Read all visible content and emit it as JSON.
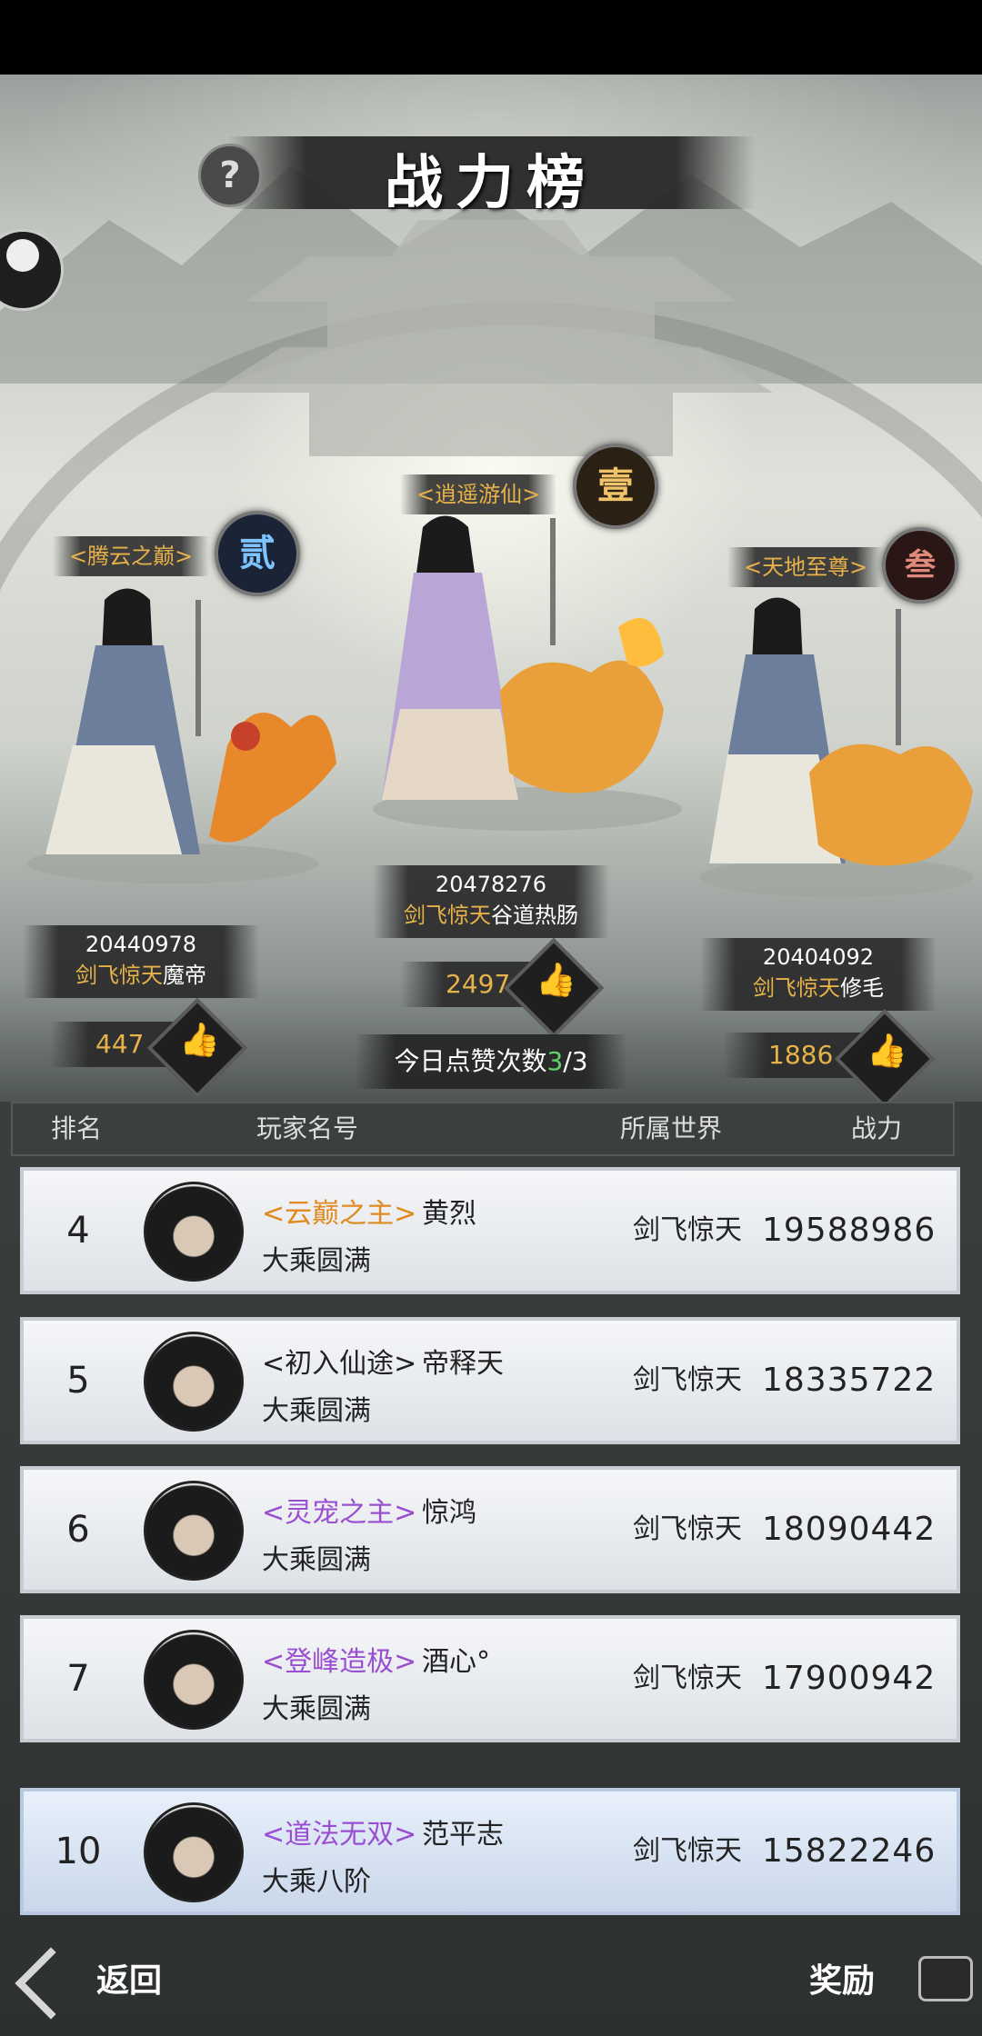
{
  "header": {
    "title": "战力榜",
    "help_icon": "?"
  },
  "top3": [
    {
      "rank_glyph": "贰",
      "title_tag": "<腾云之巅>",
      "power": "20440978",
      "world": "剑飞惊天",
      "name": "魔帝",
      "likes": "447",
      "badge_color": "#7ec3ff"
    },
    {
      "rank_glyph": "壹",
      "title_tag": "<逍遥游仙>",
      "power": "20478276",
      "world": "剑飞惊天",
      "name": "谷道热肠",
      "likes": "2497",
      "badge_color": "#f0c36a"
    },
    {
      "rank_glyph": "叁",
      "title_tag": "<天地至尊>",
      "power": "20404092",
      "world": "剑飞惊天",
      "name": "修毛",
      "likes": "1886",
      "badge_color": "#e0897a"
    }
  ],
  "daily_likes": {
    "prefix": "今日点赞次数",
    "used": "3",
    "suffix": "/3"
  },
  "table_header": {
    "rank": "排名",
    "player": "玩家名号",
    "world": "所属世界",
    "power": "战力"
  },
  "rows": [
    {
      "rank": "4",
      "tag": "<云巅之主>",
      "tag_color": "#e08a1f",
      "name": "黄烈",
      "realm": "大乘圆满",
      "world": "剑飞惊天",
      "power": "19588986"
    },
    {
      "rank": "5",
      "tag": "<初入仙途>",
      "tag_color": "#222222",
      "name": "帝释天",
      "realm": "大乘圆满",
      "world": "剑飞惊天",
      "power": "18335722"
    },
    {
      "rank": "6",
      "tag": "<灵宠之主>",
      "tag_color": "#9a4fd0",
      "name": "惊鸿",
      "realm": "大乘圆满",
      "world": "剑飞惊天",
      "power": "18090442"
    },
    {
      "rank": "7",
      "tag": "<登峰造极>",
      "tag_color": "#9a4fd0",
      "name": "酒心°",
      "realm": "大乘圆满",
      "world": "剑飞惊天",
      "power": "17900942"
    }
  ],
  "self_row": {
    "rank": "10",
    "tag": "<道法无双>",
    "tag_color": "#9a4fd0",
    "name": "范平志",
    "realm": "大乘八阶",
    "world": "剑飞惊天",
    "power": "15822246"
  },
  "footer": {
    "back": "返回",
    "reward": "奖励"
  }
}
